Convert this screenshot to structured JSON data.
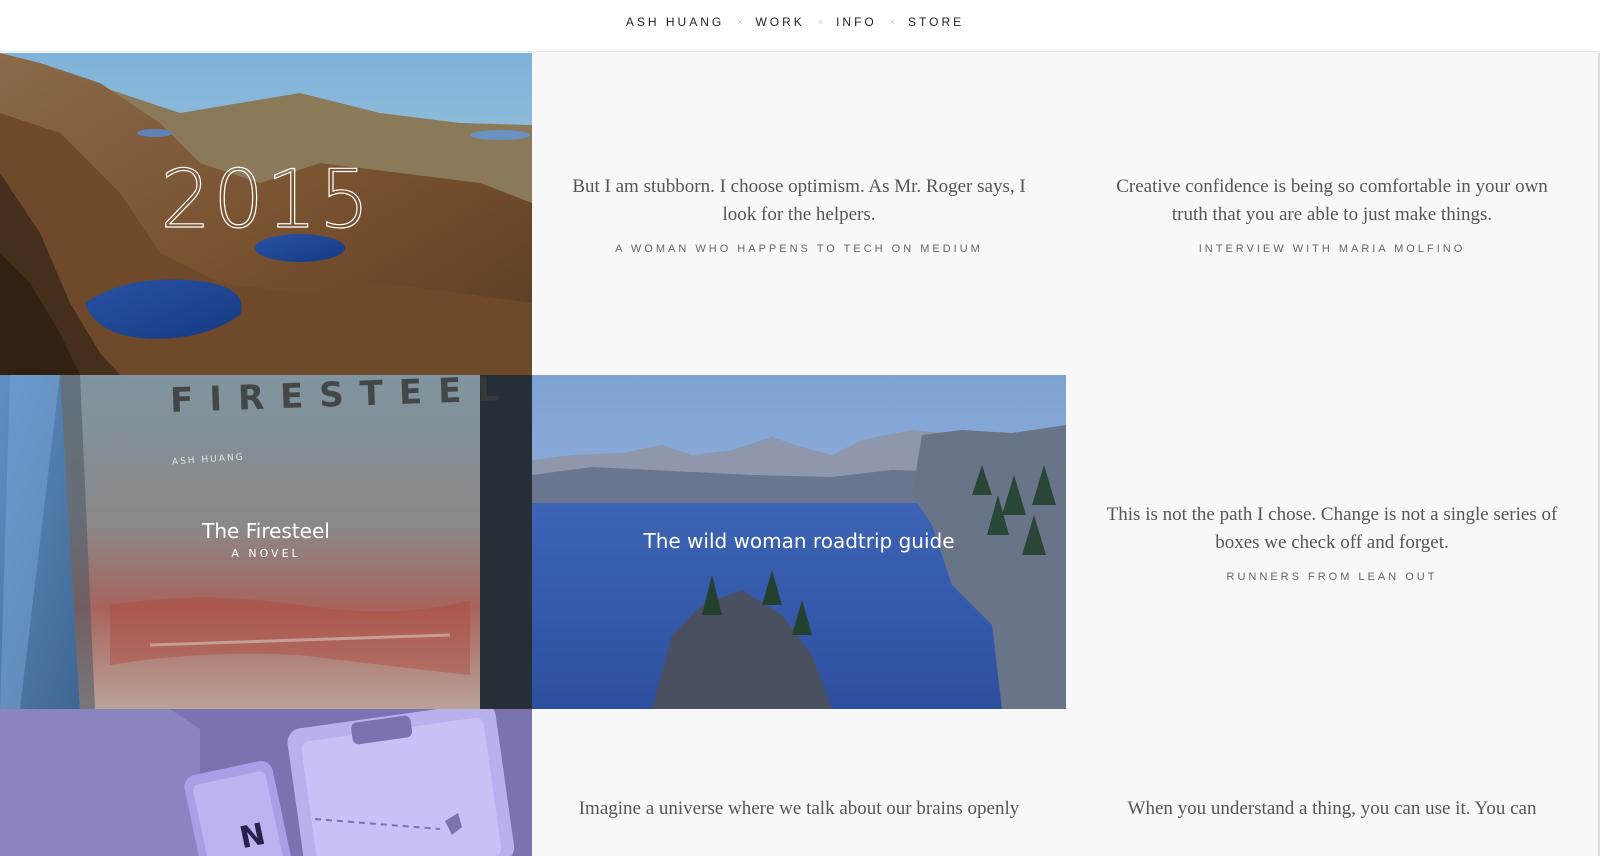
{
  "nav": {
    "items": [
      "ASH HUANG",
      "WORK",
      "INFO",
      "STORE"
    ],
    "separator": "×"
  },
  "tiles": {
    "year": {
      "label": "2015"
    },
    "quote1": {
      "text": "But I am stubborn. I choose optimism. As Mr. Roger says, I look for the helpers.",
      "source": "A WOMAN WHO HAPPENS TO TECH ON MEDIUM"
    },
    "quote2": {
      "text": "Creative confidence is being so comfortable in your own truth that you are able to just make things.",
      "source": "INTERVIEW WITH MARIA MOLFINO"
    },
    "book": {
      "cover_title": "FIRESTEEL",
      "cover_author": "ASH HUANG",
      "title": "The Firesteel",
      "subtitle": "A NOVEL"
    },
    "roadtrip": {
      "title": "The wild woman roadtrip guide"
    },
    "quote3": {
      "text": "This is not the path I chose. Change is not a single series of boxes we check off and forget.",
      "source": "RUNNERS FROM LEAN OUT"
    },
    "app": {
      "glyph": "N"
    },
    "quote4": {
      "text": "Imagine a universe where we talk about our brains openly"
    },
    "quote5": {
      "text": "When you understand a thing, you can use it. You can"
    }
  }
}
